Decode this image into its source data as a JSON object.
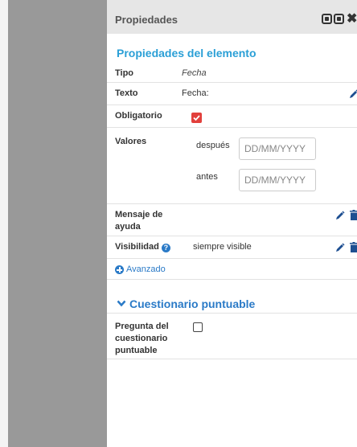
{
  "panel": {
    "title": "Propiedades",
    "section_title": "Propiedades del elemento",
    "rows": {
      "tipo": {
        "label": "Tipo",
        "value": "Fecha"
      },
      "texto": {
        "label": "Texto",
        "value": "Fecha:"
      },
      "obligatorio": {
        "label": "Obligatorio",
        "checked": true
      },
      "valores": {
        "label": "Valores",
        "after_label": "después",
        "after_placeholder": "DD/MM/YYYY",
        "before_label": "antes",
        "before_placeholder": "DD/MM/YYYY"
      },
      "mensaje": {
        "label_line1": "Mensaje de",
        "label_line2": "ayuda"
      },
      "visibilidad": {
        "label": "Visibilidad",
        "value": "siempre visible"
      }
    },
    "advanced_link": "Avanzado",
    "section2_title": "Cuestionario puntuable",
    "pregunta": {
      "label_line1": "Pregunta del",
      "label_line2": "cuestionario",
      "label_line3": "puntuable",
      "checked": false
    }
  },
  "colors": {
    "accent": "#2a9fd6",
    "link": "#2a7ac7",
    "check_red": "#e2403c",
    "side_gray": "#999999",
    "header_bg": "#e6e6e6"
  },
  "icons": [
    "maximize-icon",
    "minimize-icon",
    "close-icon",
    "pencil-icon",
    "trash-icon",
    "help-icon",
    "plus-circle-icon",
    "chevron-down-icon",
    "checkmark-icon"
  ]
}
